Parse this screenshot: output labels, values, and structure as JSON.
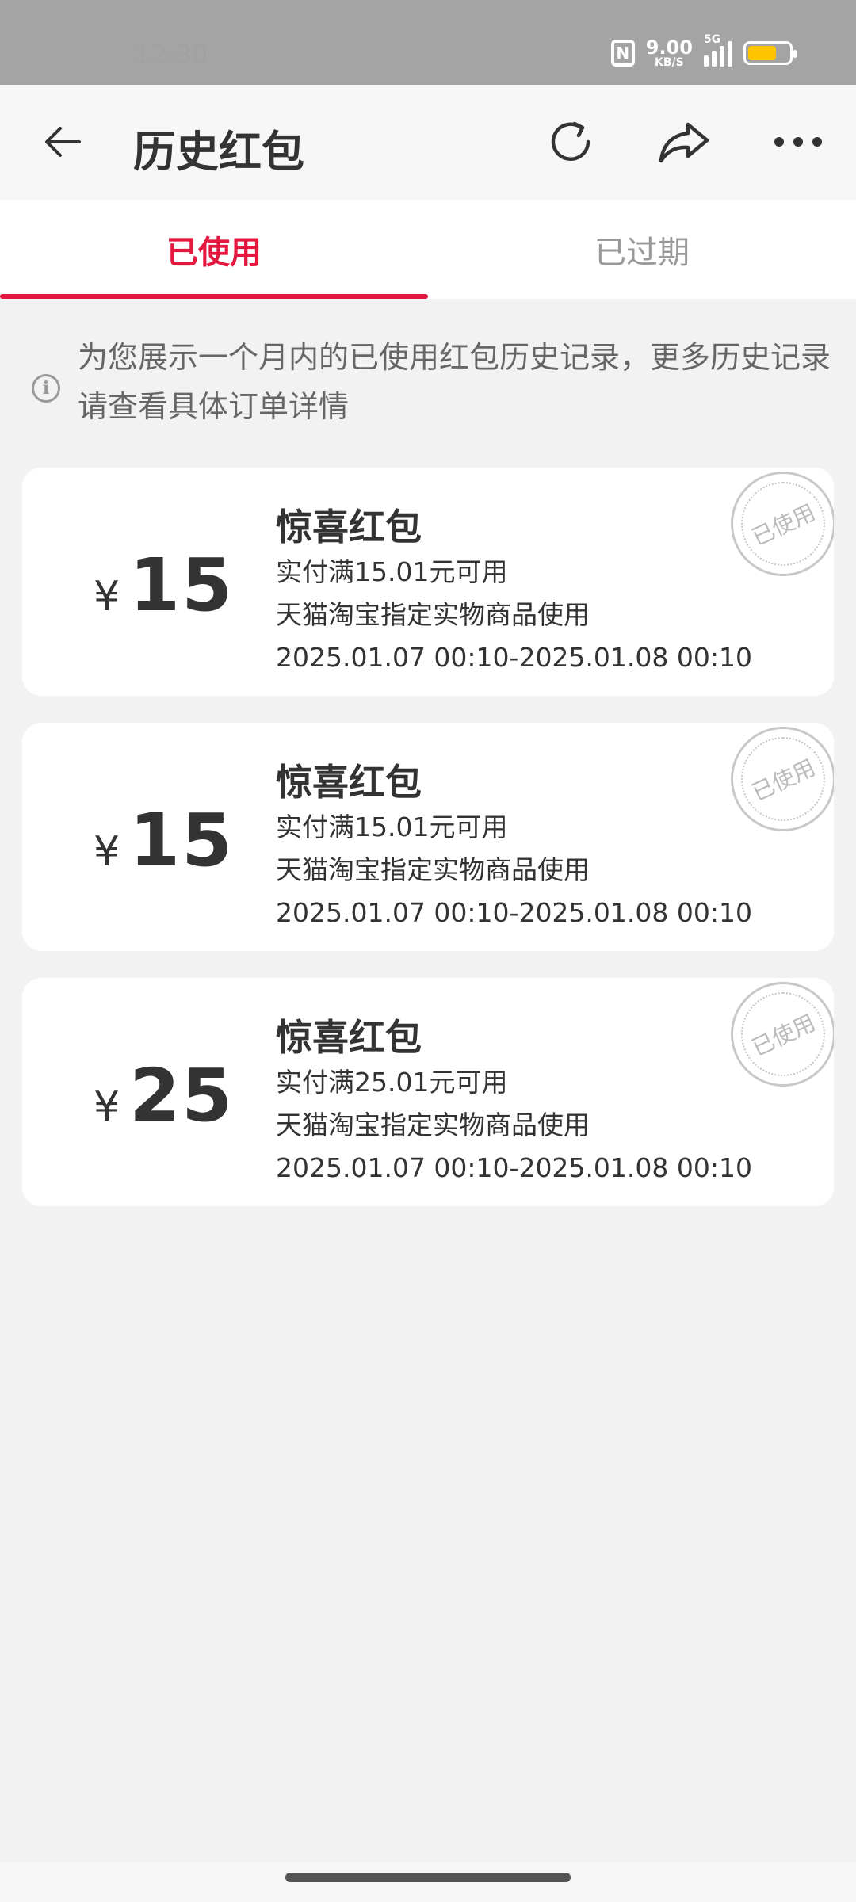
{
  "status": {
    "time": "12:30",
    "speed_value": "9.00",
    "speed_unit": "KB/S",
    "network": "5G",
    "battery_level": 0.7
  },
  "header": {
    "title": "历史红包"
  },
  "tabs": [
    {
      "label": "已使用",
      "active": true
    },
    {
      "label": "已过期",
      "active": false
    }
  ],
  "notice": "为您展示一个月内的已使用红包历史记录，更多历史记录请查看具体订单详情",
  "coupons": [
    {
      "currency": "¥",
      "amount": "15",
      "title": "惊喜红包",
      "condition": "实付满15.01元可用",
      "scope": "天猫淘宝指定实物商品使用",
      "validity": "2025.01.07 00:10-2025.01.08 00:10",
      "stamp": "已使用"
    },
    {
      "currency": "¥",
      "amount": "15",
      "title": "惊喜红包",
      "condition": "实付满15.01元可用",
      "scope": "天猫淘宝指定实物商品使用",
      "validity": "2025.01.07 00:10-2025.01.08 00:10",
      "stamp": "已使用"
    },
    {
      "currency": "¥",
      "amount": "25",
      "title": "惊喜红包",
      "condition": "实付满25.01元可用",
      "scope": "天猫淘宝指定实物商品使用",
      "validity": "2025.01.07 00:10-2025.01.08 00:10",
      "stamp": "已使用"
    }
  ],
  "colors": {
    "accent": "#e4173f",
    "background": "#f2f2f2",
    "status_bar": "#a4a4a4"
  }
}
